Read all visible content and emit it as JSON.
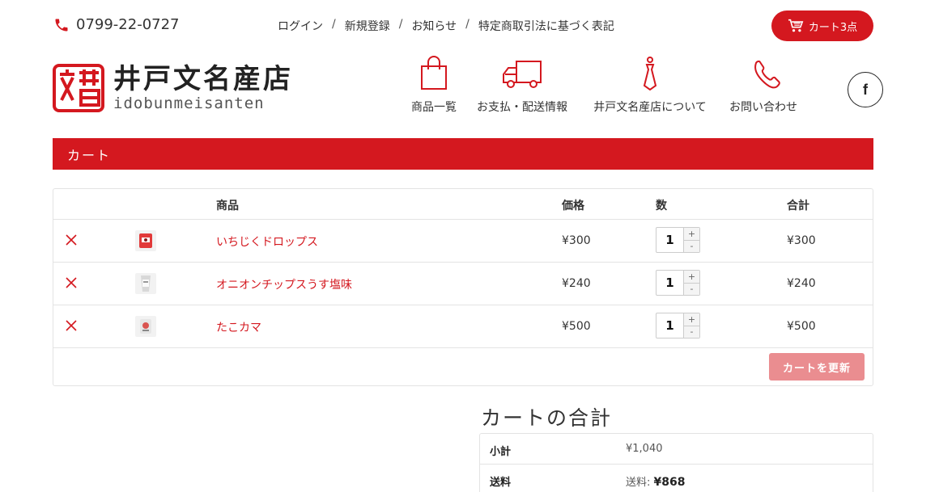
{
  "header": {
    "phone": "0799-22-0727",
    "links": [
      "ログイン",
      "新規登録",
      "お知らせ",
      "特定商取引法に基づく表記"
    ],
    "cart_button": "カート3点"
  },
  "logo": {
    "title": "井戸文名産店",
    "subtitle": "idobunmeisanten",
    "seal_text": "文井戸"
  },
  "nav": [
    {
      "label": "商品一覧",
      "icon": "shopping-bag-icon"
    },
    {
      "label": "お支払・配送情報",
      "icon": "truck-icon"
    },
    {
      "label": "井戸文名産店について",
      "icon": "necktie-icon"
    },
    {
      "label": "お問い合わせ",
      "icon": "phone-icon"
    }
  ],
  "social": {
    "facebook": "f"
  },
  "page_title": "カート",
  "cart": {
    "headers": {
      "product": "商品",
      "price": "価格",
      "qty": "数",
      "total": "合計"
    },
    "items": [
      {
        "name": "いちじくドロップス",
        "price": "¥300",
        "qty": "1",
        "total": "¥300"
      },
      {
        "name": "オニオンチップスうす塩味",
        "price": "¥240",
        "qty": "1",
        "total": "¥240"
      },
      {
        "name": "たこカマ",
        "price": "¥500",
        "qty": "1",
        "total": "¥500"
      }
    ],
    "stepper": {
      "plus": "+",
      "minus": "-"
    },
    "update_button": "カートを更新"
  },
  "totals": {
    "title": "カートの合計",
    "subtotal_label": "小計",
    "subtotal_value": "¥1,040",
    "shipping_label": "送料",
    "shipping_prefix": "送料:",
    "shipping_value": "¥868"
  },
  "colors": {
    "brand": "#d4181f",
    "update_button": "#ea8d90"
  }
}
